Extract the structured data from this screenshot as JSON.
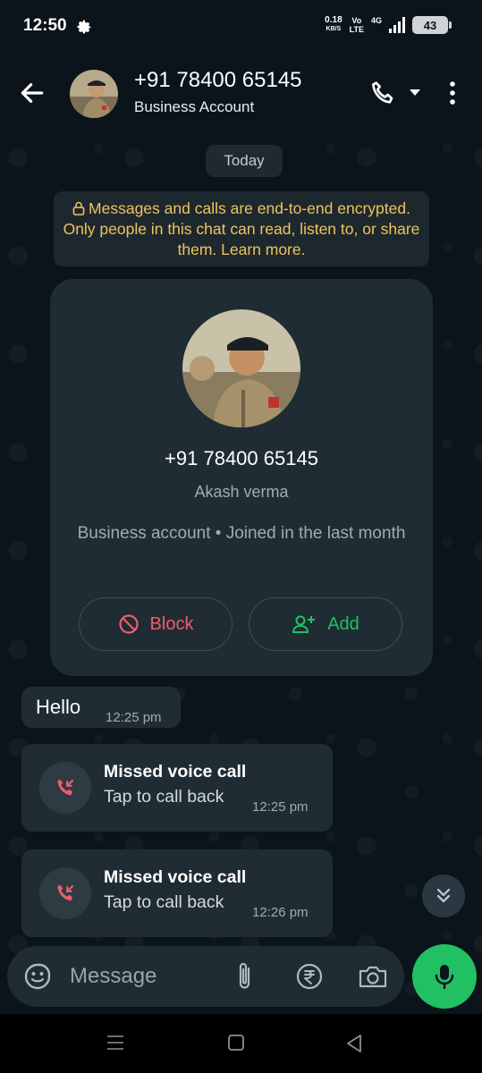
{
  "status_bar": {
    "time": "12:50",
    "net_speed_value": "0.18",
    "net_speed_unit": "KB/S",
    "volte_top": "Vo",
    "volte_bottom": "LTE",
    "network": "4G",
    "battery": "43"
  },
  "header": {
    "contact_name": "+91 78400 65145",
    "contact_subtitle": "Business Account"
  },
  "chat": {
    "date_chip": "Today",
    "encryption_notice": "Messages and calls are end-to-end encrypted. Only people in this chat can read, listen to, or share them. Learn more.",
    "profile_card": {
      "phone": "+91 78400 65145",
      "name": "Akash verma",
      "info": "Business account • Joined in the last month",
      "block_label": "Block",
      "add_label": "Add"
    },
    "messages": [
      {
        "type": "text",
        "text": "Hello",
        "time": "12:25 pm"
      },
      {
        "type": "missed_call",
        "title": "Missed voice call",
        "subtitle": "Tap to call back",
        "time": "12:25 pm"
      },
      {
        "type": "missed_call",
        "title": "Missed voice call",
        "subtitle": "Tap to call back",
        "time": "12:26 pm"
      }
    ]
  },
  "composer": {
    "placeholder": "Message"
  },
  "colors": {
    "background": "#0b141a",
    "bubble": "#1f2c33",
    "accent_green": "#21c063",
    "danger_red": "#f15c6d",
    "notice_yellow": "#f0c25e"
  },
  "icons": [
    "settings-gear-icon",
    "back-arrow-icon",
    "phone-icon",
    "dropdown-caret-icon",
    "more-vertical-icon",
    "lock-icon",
    "block-icon",
    "add-contact-icon",
    "missed-call-icon",
    "double-chevron-down-icon",
    "sticker-icon",
    "attach-icon",
    "rupee-icon",
    "camera-icon",
    "mic-icon"
  ]
}
